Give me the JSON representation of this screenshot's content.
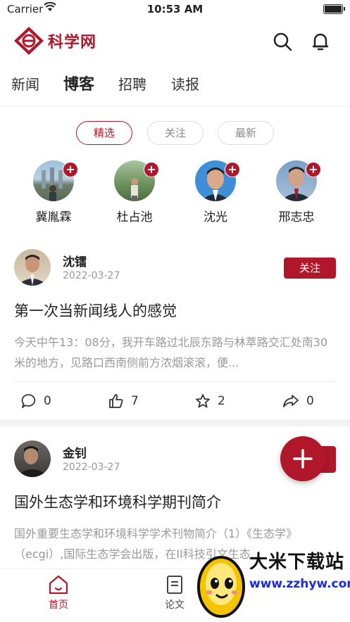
{
  "status_bar": {
    "carrier": "Carrier",
    "time": "10:53 AM"
  },
  "header": {
    "logo_text": "科学网"
  },
  "nav": {
    "tabs": [
      "新闻",
      "博客",
      "招聘",
      "读报"
    ],
    "active_index": 1
  },
  "filters": {
    "chips": [
      "精选",
      "关注",
      "最新"
    ],
    "active_index": 0
  },
  "bloggers": [
    {
      "name": "冀胤霖",
      "plus": "+"
    },
    {
      "name": "杜占池",
      "plus": "+"
    },
    {
      "name": "沈光",
      "plus": "+"
    },
    {
      "name": "邢志忠",
      "plus": "+"
    }
  ],
  "posts": [
    {
      "author": "沈镭",
      "date": "2022-03-27",
      "follow_label": "关注",
      "title": "第一次当新闻线人的感觉",
      "excerpt": "今天中午13：08分，我开车路过北辰东路与林萃路交汇处南30米的地方，见路口西南侧前方浓烟滚滚，便...",
      "comments": "0",
      "likes": "7",
      "favorites": "2",
      "shares": "0"
    },
    {
      "author": "金钊",
      "date": "2022-03-27",
      "title": "国外生态学和环境科学期刊简介",
      "excerpt": "国外重要生态学和环境科学学术刊物简介（1）《生态学》（ecgi）,国际生态学会出版，在II科技引文生态..."
    }
  ],
  "tab_bar": {
    "tabs": [
      "首页",
      "论文"
    ],
    "active_index": 0
  },
  "watermark": {
    "text": "大米下载站",
    "url": "www.zzhyw.com"
  },
  "colors": {
    "accent": "#b0172a"
  }
}
